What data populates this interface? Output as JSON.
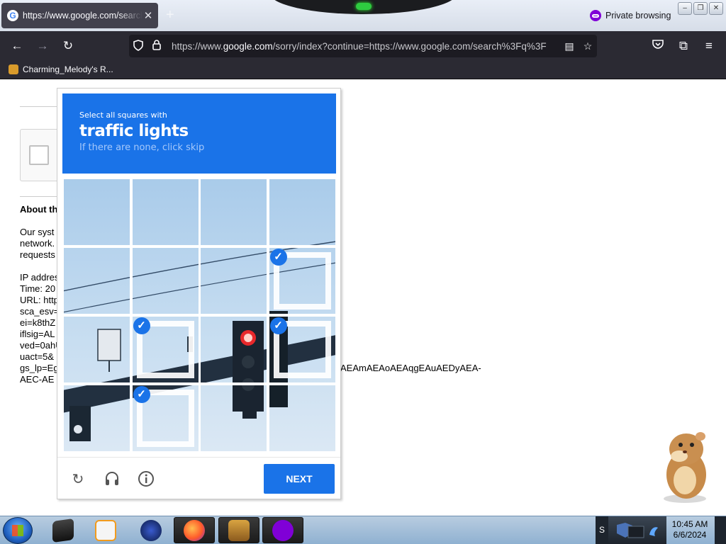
{
  "browser": {
    "tab_title": "https://www.google.com/search?q",
    "tab_favicon": "G",
    "new_tab": "+",
    "private_label": "Private browsing",
    "url_prefix": "https://www.",
    "url_domain": "google.com",
    "url_rest": "/sorry/index?continue=https://www.google.com/search%3Fq%3F",
    "bookmark": "Charming_Melody's R...",
    "icons": [
      "back-icon",
      "forward-icon",
      "reload-icon",
      "shield-icon",
      "lock-icon",
      "reader-icon",
      "star-icon",
      "pocket-icon",
      "extensions-icon",
      "menu-icon"
    ]
  },
  "sorry_page": {
    "about": "About th",
    "line1": "Our syst",
    "line2": "network.",
    "line3": "requests",
    "ip": "IP addres",
    "time": "Time: 20",
    "url": "URL: http",
    "sca": "sca_esv=",
    "ei": "ei=k8thZ",
    "iflsig": "iflsig=AL",
    "ved": "ved=0ahU",
    "uact": "uact=5&",
    "gslp": "gs_lp=Eg",
    "aec": "AEC-AE",
    "tail": "AEAmAEAoAEAqgEAuAEDyAEA-"
  },
  "captcha": {
    "instruction": "Select all squares with",
    "target": "traffic lights",
    "hint": "If there are none, click skip",
    "next_label": "NEXT",
    "selected_tiles": [
      8,
      10,
      12,
      14
    ],
    "colors": {
      "brand": "#1a73e8",
      "sky": "#b9d6ee",
      "pole": "#1f2d3a",
      "red_light": "#e8282b"
    }
  },
  "taskbar": {
    "clock_time": "10:45 AM",
    "clock_date": "6/6/2024",
    "tray_letter": "S",
    "items": [
      "start-orb",
      "terminal-app",
      "media-player",
      "firefox-dark",
      "firefox",
      "sandboxie",
      "private-browsing"
    ]
  }
}
